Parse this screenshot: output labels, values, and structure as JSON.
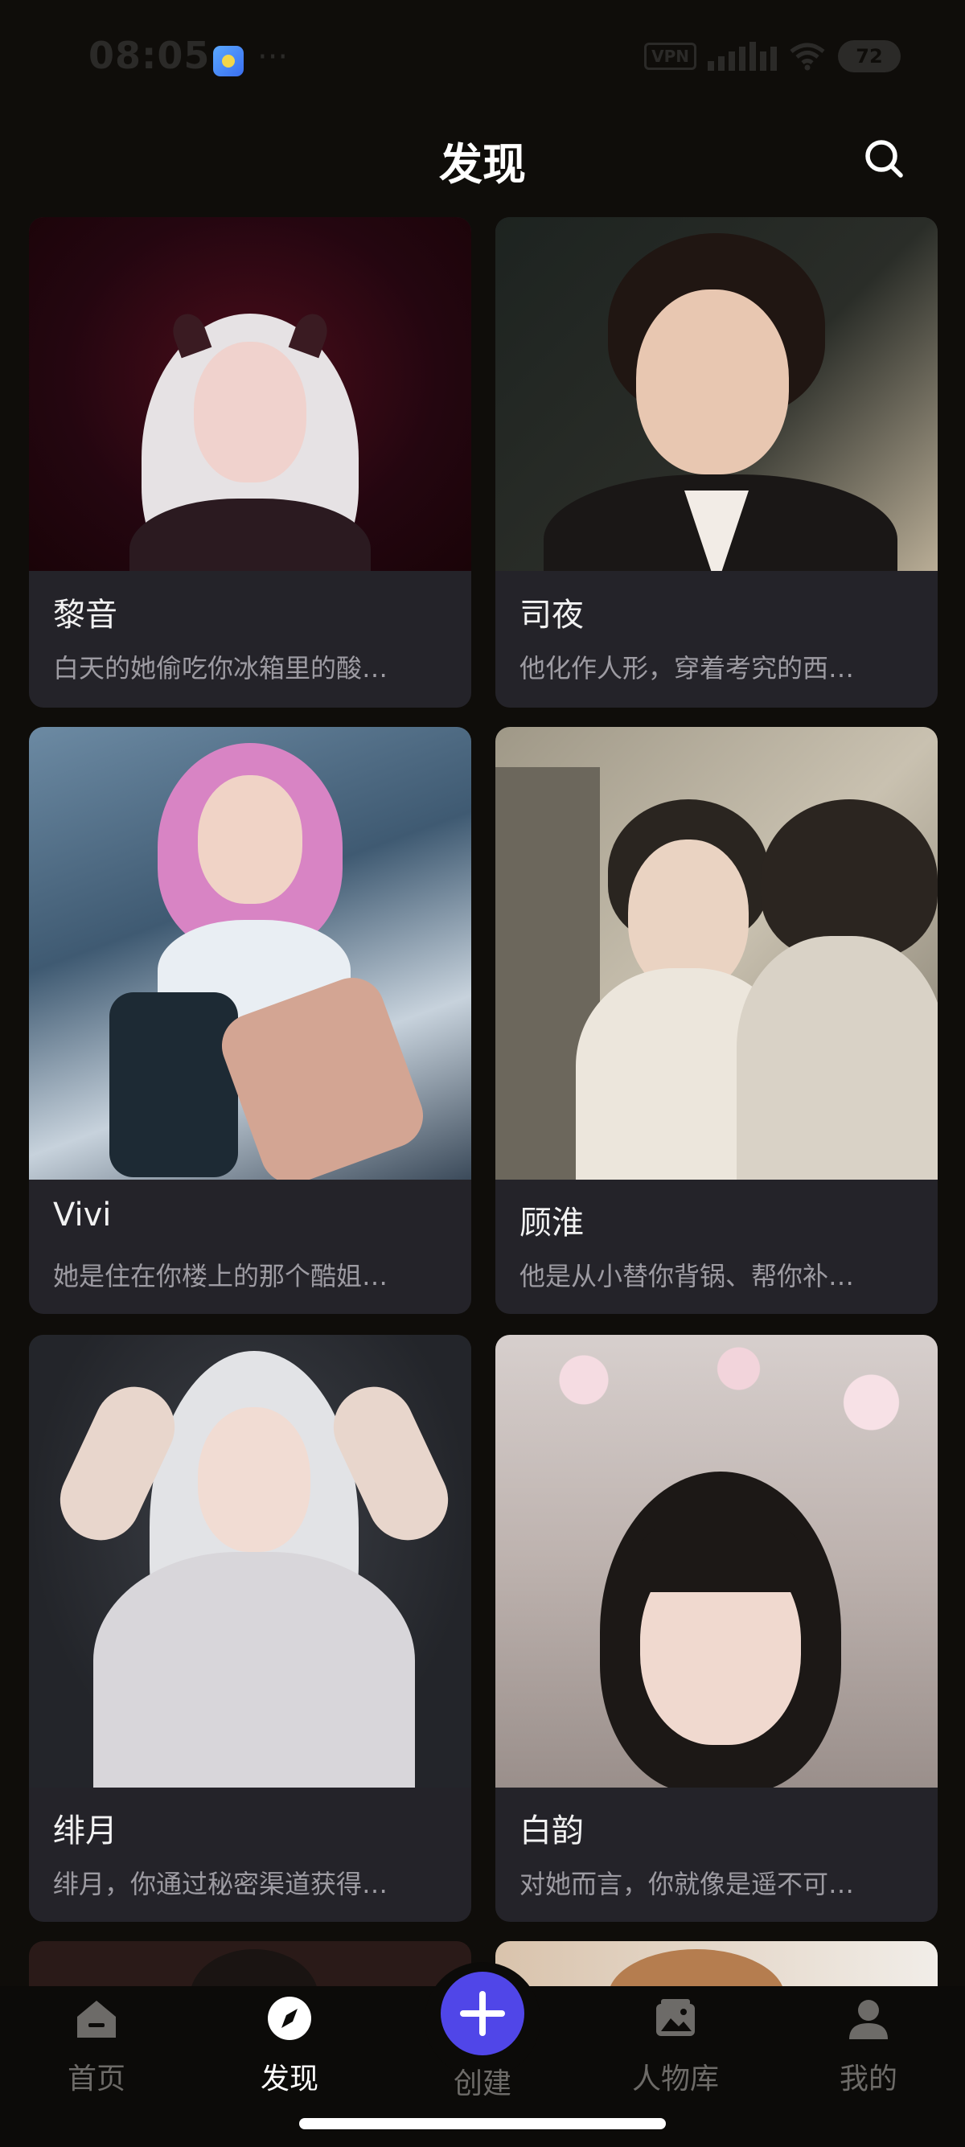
{
  "status_bar": {
    "time": "08:05",
    "dots": "···",
    "vpn": "VPN",
    "battery": "72"
  },
  "header": {
    "title": "发现"
  },
  "cards": [
    {
      "name": "黎音",
      "desc": "白天的她偷吃你冰箱里的酸…"
    },
    {
      "name": "司夜",
      "desc": "他化作人形，穿着考究的西…"
    },
    {
      "name": "Vivi",
      "desc": "她是住在你楼上的那个酷姐…"
    },
    {
      "name": "顾淮",
      "desc": "他是从小替你背锅、帮你补…"
    },
    {
      "name": "绯月",
      "desc": "绯月，你通过秘密渠道获得…"
    },
    {
      "name": "白韵",
      "desc": "对她而言，你就像是遥不可…"
    }
  ],
  "nav": {
    "home": "首页",
    "discover": "发现",
    "create": "创建",
    "characters": "人物库",
    "mine": "我的"
  },
  "colors": {
    "accent": "#5046e8",
    "background": "#0f0d0a",
    "card": "#242329"
  }
}
